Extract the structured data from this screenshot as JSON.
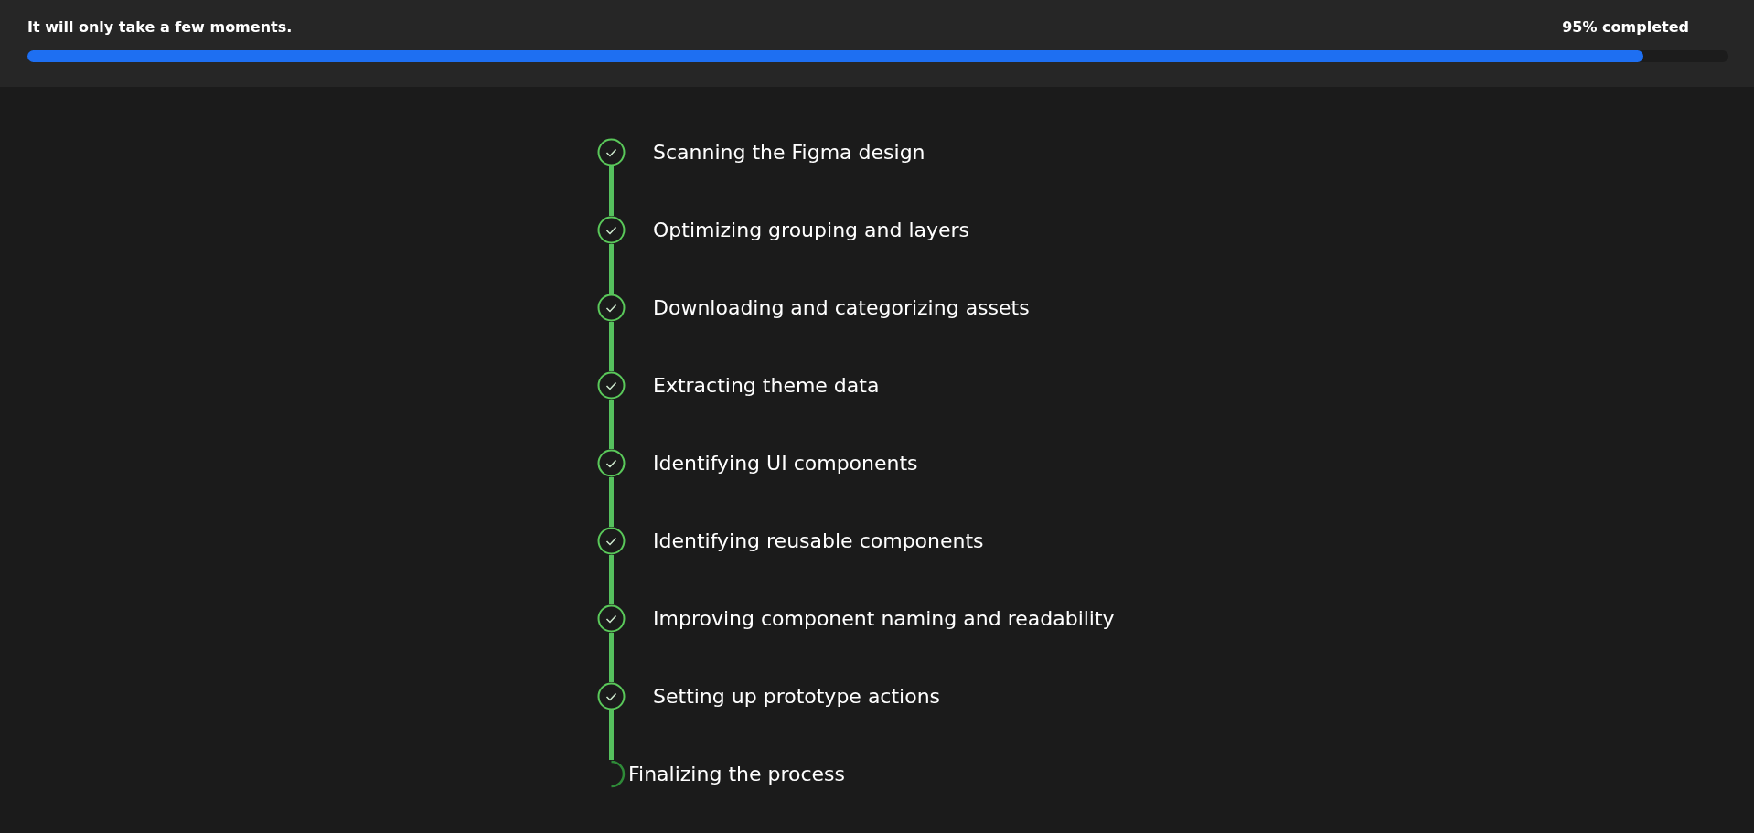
{
  "header": {
    "message": "It will only take a few moments.",
    "status": "95% completed",
    "progress": {
      "level": 0.95
    }
  },
  "steps": [
    {
      "label": "Scanning the Figma design",
      "done": true
    },
    {
      "label": "Optimizing grouping and layers",
      "done": true
    },
    {
      "label": "Downloading and categorizing assets",
      "done": true
    },
    {
      "label": "Extracting theme data",
      "done": true
    },
    {
      "label": "Identifying UI components",
      "done": true
    },
    {
      "label": "Identifying reusable components",
      "done": true
    },
    {
      "label": "Improving component naming and readability",
      "done": true
    },
    {
      "label": "Setting up prototype actions",
      "done": true
    },
    {
      "label": "Finalizing the process",
      "done": false
    }
  ]
}
